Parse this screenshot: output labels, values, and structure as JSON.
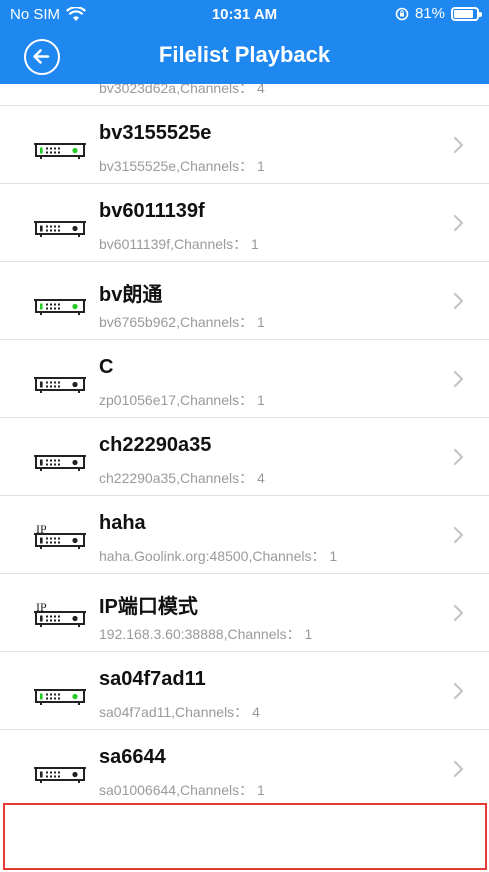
{
  "status_bar": {
    "carrier": "No SIM",
    "time": "10:31 AM",
    "battery": "81%"
  },
  "nav": {
    "title": "Filelist Playback",
    "back_icon": "back-arrow-circle-icon"
  },
  "colors": {
    "header": "#1e88f0",
    "led_on": "#22cc22",
    "highlight_border": "#e53935"
  },
  "devices": [
    {
      "name": "",
      "detail": "bv3023d62a,Channels： 4",
      "icon": "dvr-icon",
      "online": true
    },
    {
      "name": "bv3155525e",
      "detail": "bv3155525e,Channels： 1",
      "icon": "dvr-icon",
      "online": true
    },
    {
      "name": "bv6011139f",
      "detail": "bv6011139f,Channels： 1",
      "icon": "dvr-icon",
      "online": false
    },
    {
      "name": "bv朗通",
      "detail": "bv6765b962,Channels： 1",
      "icon": "dvr-icon",
      "online": true
    },
    {
      "name": "C",
      "detail": "zp01056e17,Channels： 1",
      "icon": "dvr-icon",
      "online": false
    },
    {
      "name": "ch22290a35",
      "detail": "ch22290a35,Channels： 4",
      "icon": "dvr-icon",
      "online": false
    },
    {
      "name": "haha",
      "detail": "haha.Goolink.org:48500,Channels： 1",
      "icon": "ip-dvr-icon",
      "online": false
    },
    {
      "name": "IP端口模式",
      "detail": "192.168.3.60:38888,Channels： 1",
      "icon": "ip-dvr-icon",
      "online": false
    },
    {
      "name": "sa04f7ad11",
      "detail": "sa04f7ad11,Channels： 4",
      "icon": "dvr-icon",
      "online": true
    },
    {
      "name": "sa6644",
      "detail": "sa01006644,Channels： 1",
      "icon": "dvr-icon",
      "online": false
    }
  ]
}
